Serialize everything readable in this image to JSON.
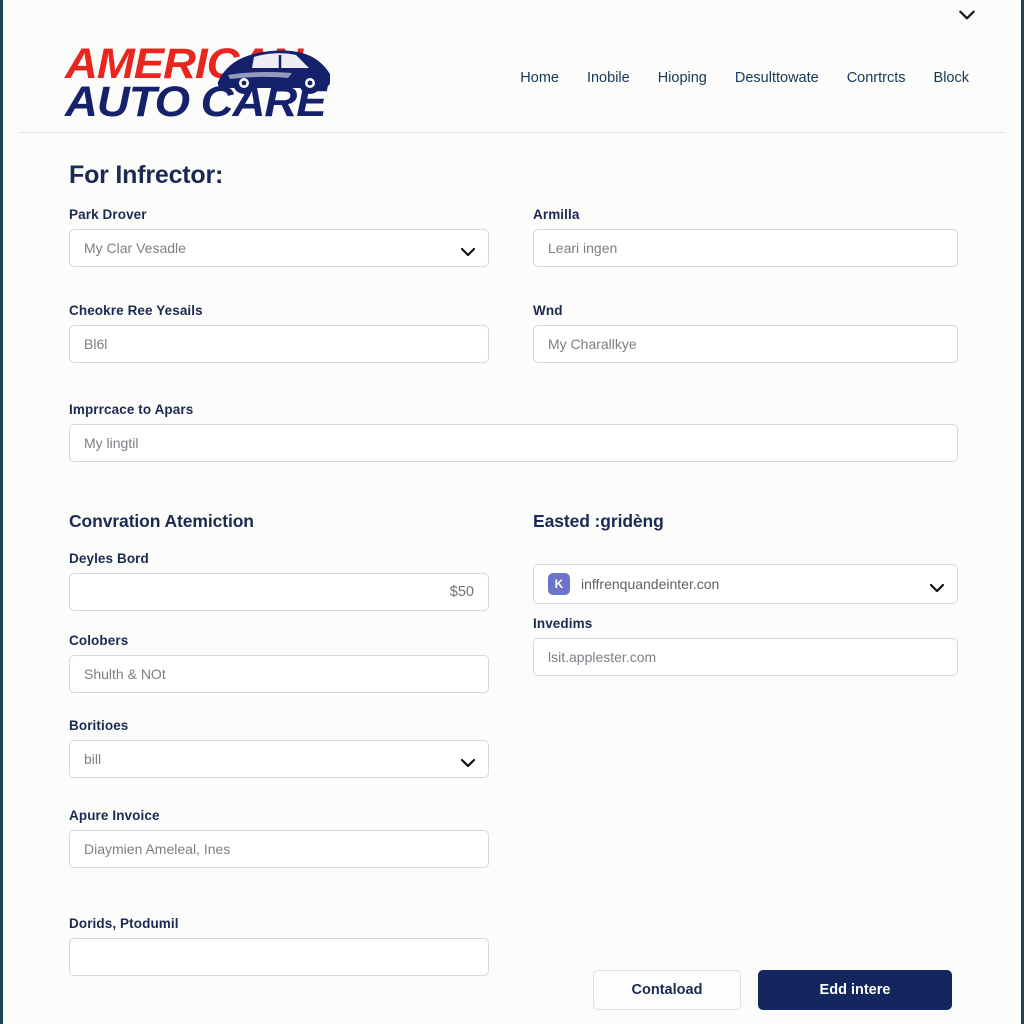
{
  "brand": {
    "logo_line1": "AMERICAN",
    "logo_line2": "AUTO CARE",
    "logo_color_primary": "#e8251f",
    "logo_color_secondary": "#16216b"
  },
  "topbar": {
    "chevron_icon": "chevron-down-icon"
  },
  "nav": {
    "items": [
      {
        "label": "Home"
      },
      {
        "label": "Inobile"
      },
      {
        "label": "Hioping"
      },
      {
        "label": "Desulttowate"
      },
      {
        "label": "Conrtrcts"
      },
      {
        "label": "Block"
      }
    ]
  },
  "page": {
    "title": "For Infrector:",
    "section_two_left": "Convration Atemiction",
    "section_two_right": "Easted :gridèng"
  },
  "fields": {
    "park_drover": {
      "label": "Park Drover",
      "value": "My Clar Vesadle",
      "type": "select"
    },
    "armilla": {
      "label": "Armilla",
      "value": "Leari ingen",
      "type": "text"
    },
    "cheokre": {
      "label": "Cheokre Ree Yesails",
      "value": "Bl6l",
      "type": "text"
    },
    "wnd": {
      "label": "Wnd",
      "value": "My Charallkye",
      "type": "text"
    },
    "imprrcace": {
      "label": "Imprrcace to Apars",
      "value": "My lingtil",
      "type": "text"
    },
    "deyles_bord": {
      "label": "Deyles Bord",
      "value": "$50",
      "type": "text"
    },
    "colobers": {
      "label": "Colobers",
      "value": "Shulth & NOt",
      "type": "text"
    },
    "boritioes": {
      "label": "Boritioes",
      "value": "bill",
      "type": "select"
    },
    "apure_invoice": {
      "label": "Apure Invoice",
      "value": "Diaymien Ameleal, Ines",
      "type": "text"
    },
    "dorids": {
      "label": "Dorids, Ptodumil",
      "value": "",
      "type": "text"
    },
    "easted_select": {
      "value": "inffrenquandeinter.con",
      "type": "select",
      "badge_letter": "K",
      "badge_color": "#6b74c8"
    },
    "invedims": {
      "label": "Invedims",
      "value": "lsit.applester.com",
      "type": "text"
    }
  },
  "actions": {
    "secondary_label": "Contaload",
    "primary_label": "Edd intere",
    "primary_color": "#13265e"
  }
}
